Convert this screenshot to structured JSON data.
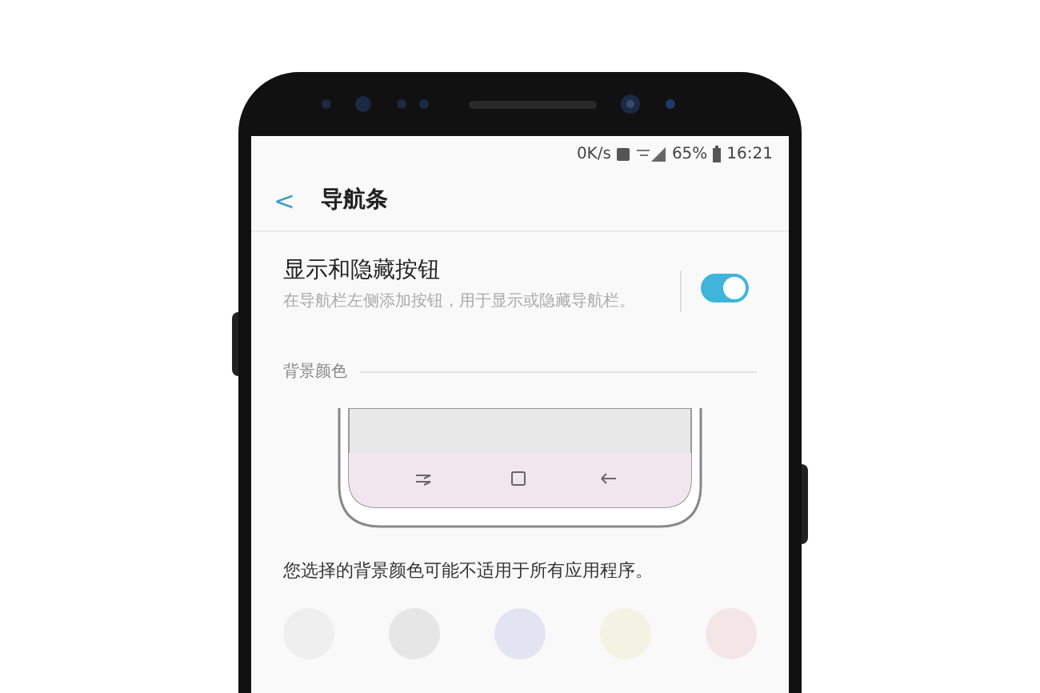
{
  "status_bar": {
    "speed": "0K/s",
    "battery": "65%",
    "time": "16:21"
  },
  "header": {
    "back": "<",
    "title": "导航条"
  },
  "setting": {
    "title": "显示和隐藏按钮",
    "description": "在导航栏左侧添加按钮，用于显示或隐藏导航栏。",
    "on": true
  },
  "section": {
    "title": "背景颜色"
  },
  "note": "您选择的背景颜色可能不适用于所有应用程序。",
  "swatches": [
    {
      "color": "#efefef"
    },
    {
      "color": "#e6e6e6"
    },
    {
      "color": "#e2e4f2"
    },
    {
      "color": "#f3f3e4"
    },
    {
      "color": "#f4e6e6"
    }
  ]
}
